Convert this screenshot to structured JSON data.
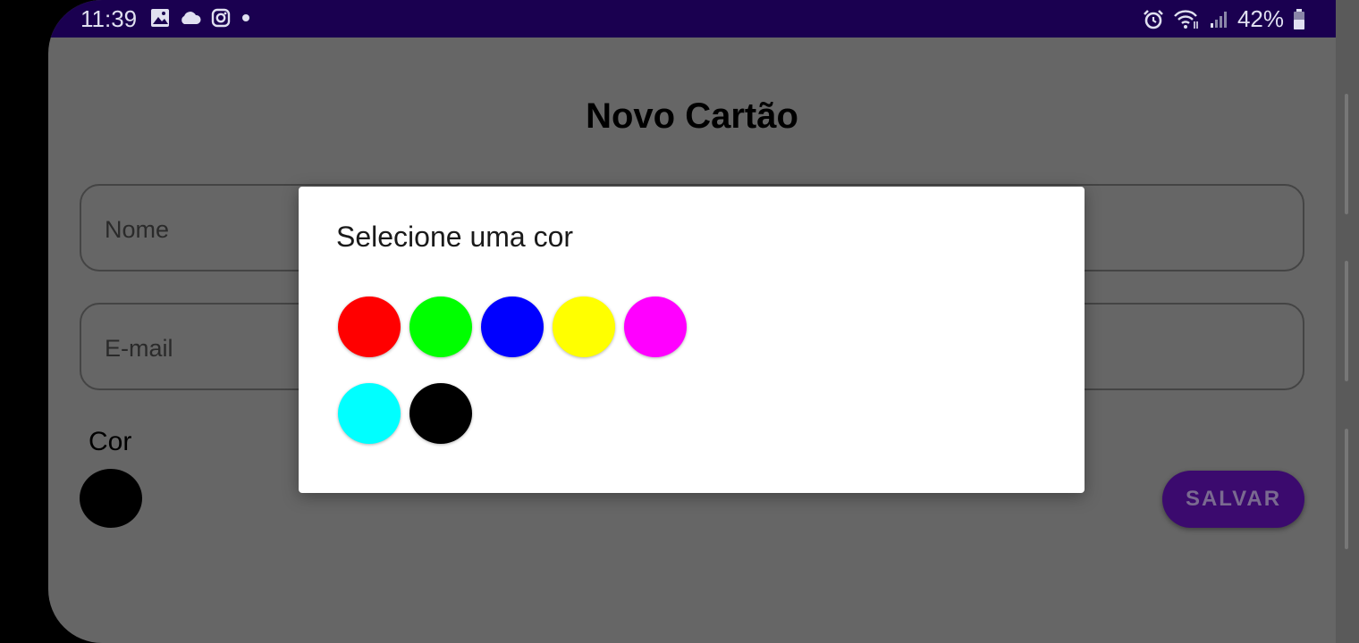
{
  "status_bar": {
    "time": "11:39",
    "battery": "42%",
    "left_icons": [
      "gallery-icon",
      "cloud-icon",
      "instagram-icon",
      "dot-icon"
    ],
    "right_icons": [
      "alarm-icon",
      "wifi-icon",
      "signal-icon",
      "battery-icon"
    ]
  },
  "page": {
    "title": "Novo Cartão",
    "name_placeholder": "Nome",
    "email_placeholder": "E-mail",
    "color_label": "Cor",
    "selected_color": "#000000",
    "save_label": "SALVAR"
  },
  "dialog": {
    "title": "Selecione uma cor",
    "colors": [
      "#ff0000",
      "#00ff00",
      "#0000ff",
      "#ffff00",
      "#ff00ff",
      "#00ffff",
      "#000000"
    ]
  },
  "theme": {
    "status_bar_bg": "#1a0050",
    "scrim": "#666666",
    "save_button_bg": "#3b0a6e"
  }
}
